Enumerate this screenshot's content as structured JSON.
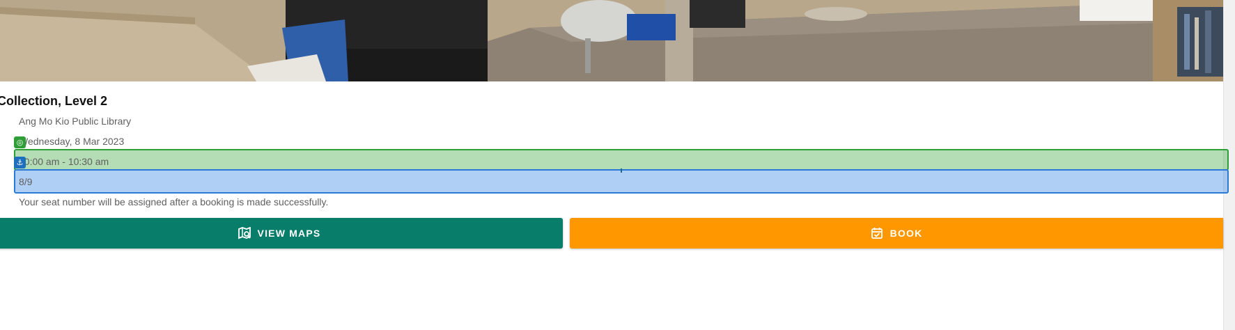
{
  "hero": {
    "image": "library-seating-photo"
  },
  "venue": {
    "title": "Collection, Level 2",
    "library": "Ang Mo Kio Public Library",
    "date": "Wednesday, 8 Mar 2023",
    "time": "10:00 am - 10:30 am",
    "seats": "8/9",
    "note": "Your seat number will be assigned after a booking is made successfully."
  },
  "buttons": {
    "view_maps": "VIEW MAPS",
    "book": "BOOK"
  },
  "icons": {
    "view_maps": "map-search-icon",
    "book": "calendar-check-icon",
    "marker_green": "target-icon",
    "marker_blue": "anchor-icon"
  },
  "colors": {
    "view_maps_button": "#077d6a",
    "book_button": "#ff9800",
    "highlight_green": "#2e9e36",
    "highlight_blue": "#2b79d6"
  }
}
